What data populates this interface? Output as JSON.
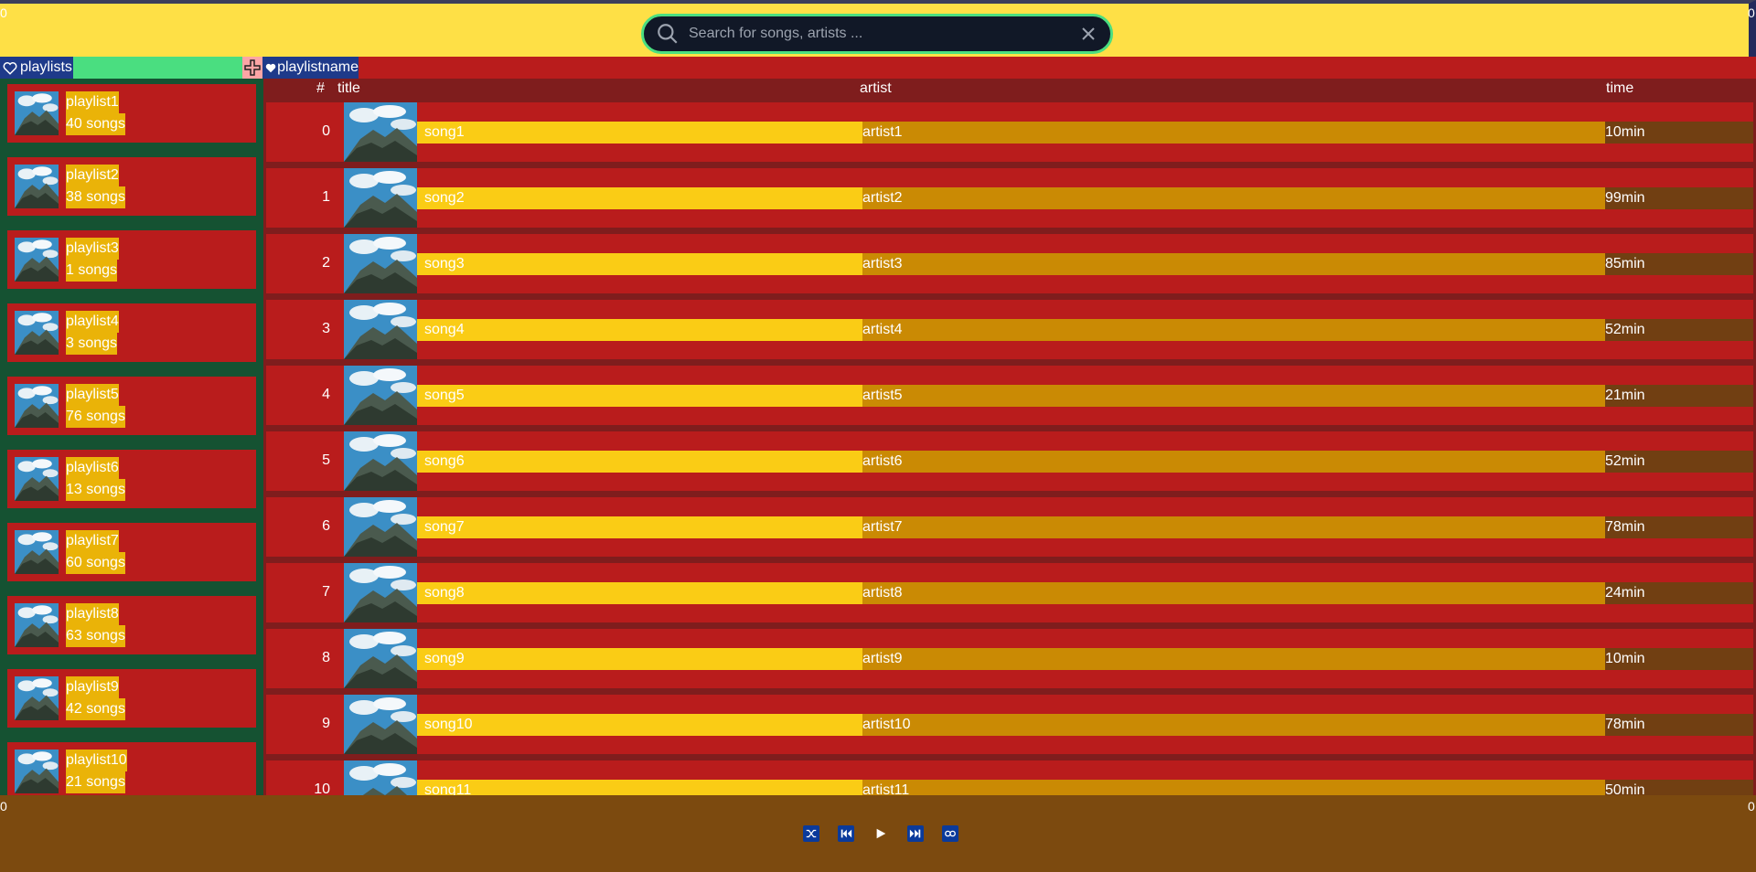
{
  "edge_counters": {
    "top_left": "0",
    "top_right": "0",
    "bottom_left": "0",
    "bottom_right": "0"
  },
  "search": {
    "placeholder": "Search for songs, artists ..."
  },
  "tabs": {
    "playlists_label": "playlists",
    "playlistname_label": "playlistname"
  },
  "playlists": [
    {
      "name": "playlist1",
      "count": "40 songs"
    },
    {
      "name": "playlist2",
      "count": "38 songs"
    },
    {
      "name": "playlist3",
      "count": "1 songs"
    },
    {
      "name": "playlist4",
      "count": "3 songs"
    },
    {
      "name": "playlist5",
      "count": "76 songs"
    },
    {
      "name": "playlist6",
      "count": "13 songs"
    },
    {
      "name": "playlist7",
      "count": "60 songs"
    },
    {
      "name": "playlist8",
      "count": "63 songs"
    },
    {
      "name": "playlist9",
      "count": "42 songs"
    },
    {
      "name": "playlist10",
      "count": "21 songs"
    }
  ],
  "table": {
    "headers": {
      "num": "#",
      "title": "title",
      "artist": "artist",
      "time": "time"
    },
    "rows": [
      {
        "num": "0",
        "title": "song1",
        "artist": "artist1",
        "time": "10min"
      },
      {
        "num": "1",
        "title": "song2",
        "artist": "artist2",
        "time": "99min"
      },
      {
        "num": "2",
        "title": "song3",
        "artist": "artist3",
        "time": "85min"
      },
      {
        "num": "3",
        "title": "song4",
        "artist": "artist4",
        "time": "52min"
      },
      {
        "num": "4",
        "title": "song5",
        "artist": "artist5",
        "time": "21min"
      },
      {
        "num": "5",
        "title": "song6",
        "artist": "artist6",
        "time": "52min"
      },
      {
        "num": "6",
        "title": "song7",
        "artist": "artist7",
        "time": "78min"
      },
      {
        "num": "7",
        "title": "song8",
        "artist": "artist8",
        "time": "24min"
      },
      {
        "num": "8",
        "title": "song9",
        "artist": "artist9",
        "time": "10min"
      },
      {
        "num": "9",
        "title": "song10",
        "artist": "artist10",
        "time": "78min"
      },
      {
        "num": "10",
        "title": "song11",
        "artist": "artist11",
        "time": "50min"
      }
    ]
  },
  "player": {
    "controls": [
      "shuffle-icon",
      "previous-icon",
      "play-icon",
      "next-icon",
      "repeat-icon"
    ]
  }
}
